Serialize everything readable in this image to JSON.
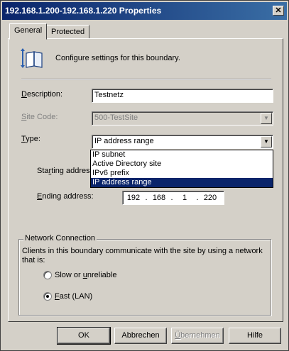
{
  "window": {
    "title": "192.168.1.200-192.168.1.220 Properties",
    "close_glyph": "✕"
  },
  "tabs": [
    {
      "label": "General",
      "active": true
    },
    {
      "label": "Protected",
      "active": false
    }
  ],
  "general": {
    "header_text": "Configure settings for this boundary.",
    "description": {
      "label_u": "D",
      "label_rest": "escription:",
      "value": "Testnetz"
    },
    "site_code": {
      "label_u": "S",
      "label_rest": "ite Code:",
      "value": "500-TestSite"
    },
    "type": {
      "label_u": "T",
      "label_rest": "ype:",
      "value": "IP address range",
      "options": [
        "IP subnet",
        "Active Directory site",
        "IPv6 prefix",
        "IP address range"
      ],
      "selected_index": 3
    },
    "starting_address": {
      "label_pre": "Sta",
      "label_u": "r",
      "label_rest": "ting address"
    },
    "ending_address": {
      "label_u": "E",
      "label_rest": "nding address:",
      "octets": [
        "192",
        "168",
        "1",
        "220"
      ]
    }
  },
  "network": {
    "caption": "Network Connection",
    "description": "Clients in this boundary communicate with the site by using a network that is:",
    "slow_label_pre": "Slow or ",
    "slow_label_u": "u",
    "slow_label_rest": "nreliable",
    "fast_label_u": "F",
    "fast_label_rest": "ast (LAN)",
    "selected": "fast"
  },
  "buttons": {
    "ok": "OK",
    "cancel": "Abbrechen",
    "apply_u": "Ü",
    "apply_rest": "bernehmen",
    "help": "Hilfe"
  }
}
